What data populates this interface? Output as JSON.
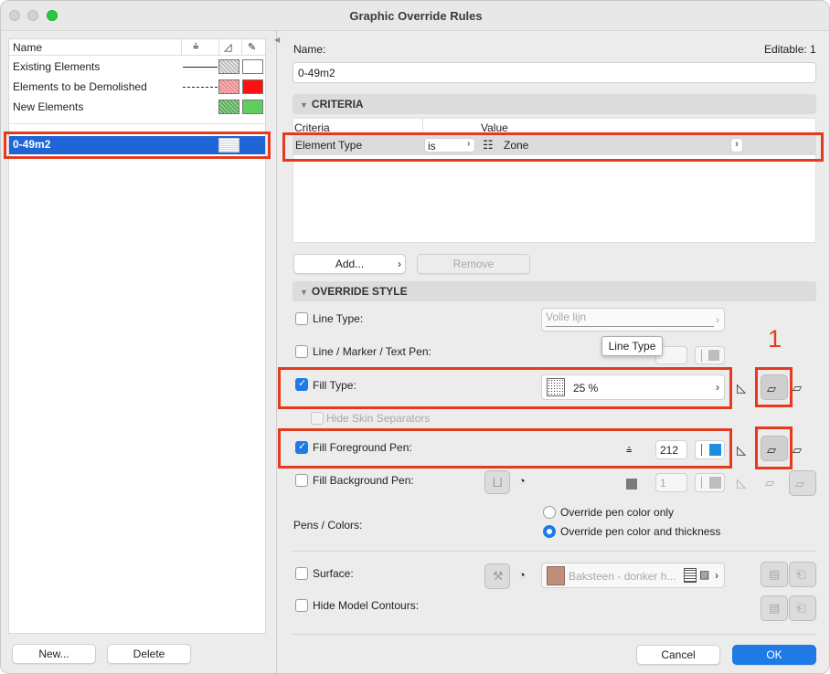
{
  "window": {
    "title": "Graphic Override Rules"
  },
  "rules": {
    "header": {
      "name": "Name"
    },
    "items": [
      {
        "label": "Existing Elements"
      },
      {
        "label": "Elements to be Demolished"
      },
      {
        "label": "New Elements"
      }
    ],
    "selected": {
      "label": "0-49m2"
    },
    "new_button": "New...",
    "delete_button": "Delete"
  },
  "detail": {
    "name_label": "Name:",
    "editable": "Editable: 1",
    "name_value": "0-49m2",
    "criteria_title": "CRITERIA",
    "criteria_col": "Criteria",
    "value_col": "Value",
    "criteria_row": {
      "criteria": "Element Type",
      "operator": "is",
      "value": "Zone"
    },
    "add_button": "Add...",
    "remove_button": "Remove",
    "override_title": "OVERRIDE STYLE",
    "line_type": {
      "label": "Line Type:",
      "value": "Volle lijn",
      "checked": false
    },
    "line_pen": {
      "label": "Line / Marker / Text Pen:",
      "checked": false
    },
    "tooltip": "Line Type",
    "fill_type": {
      "label": "Fill Type:",
      "value": "25 %",
      "checked": true
    },
    "hide_skin": {
      "label": "Hide Skin Separators",
      "checked": false
    },
    "fill_fg": {
      "label": "Fill Foreground Pen:",
      "pen": "212",
      "checked": true
    },
    "fill_bg": {
      "label": "Fill Background Pen:",
      "pen": "1",
      "checked": false
    },
    "pens_colors": {
      "label": "Pens / Colors:",
      "option1": "Override pen color only",
      "option2": "Override pen color and thickness",
      "selected": "option2"
    },
    "surface": {
      "label": "Surface:",
      "value": "Baksteen - donker h...",
      "checked": false
    },
    "hide_contours": {
      "label": "Hide Model Contours:",
      "checked": false
    },
    "annotation": "1",
    "cancel_button": "Cancel",
    "ok_button": "OK"
  },
  "colors": {
    "accent": "#1f7ae6",
    "highlight": "#e53a1e",
    "pen212": "#1a8fe0",
    "surface": "#c08f7c"
  }
}
